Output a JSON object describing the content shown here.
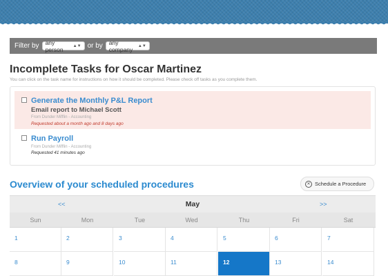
{
  "filter": {
    "filter_by": "Filter by",
    "person_value": "any person",
    "or_by": "or by",
    "company_value": "any company"
  },
  "page": {
    "title": "Incomplete Tasks for Oscar Martinez",
    "instructions": "You can click on the task name for instructions on how it should be completed. Please check off tasks as you complete them."
  },
  "tasks": [
    {
      "title": "Generate the Monthly P&L Report",
      "subtask": "Email report to Michael Scott",
      "from": "From Dunder Mifflin - Accounting",
      "requested": "Requested about a month ago and 8 days ago"
    },
    {
      "title": "Run Payroll",
      "from": "From Dunder Mifflin - Accounting",
      "requested": "Requested 41 minutes ago"
    }
  ],
  "overview": {
    "title": "Overview of your scheduled procedures",
    "schedule_button": "Schedule a Procedure"
  },
  "calendar": {
    "prev": "<<",
    "next": ">>",
    "month": "May",
    "days_of_week": [
      "Sun",
      "Mon",
      "Tue",
      "Wed",
      "Thu",
      "Fri",
      "Sat"
    ],
    "weeks": [
      [
        "1",
        "2",
        "3",
        "4",
        "5",
        "6",
        "7"
      ],
      [
        "8",
        "9",
        "10",
        "11",
        "12",
        "13",
        "14"
      ]
    ],
    "today": "12"
  },
  "colors": {
    "banner": "#3d7fae",
    "link": "#3a8ccf",
    "highlight_task_bg": "#fbe9e6",
    "today_cell": "#1577c8",
    "overdue_text": "#c0392b"
  }
}
